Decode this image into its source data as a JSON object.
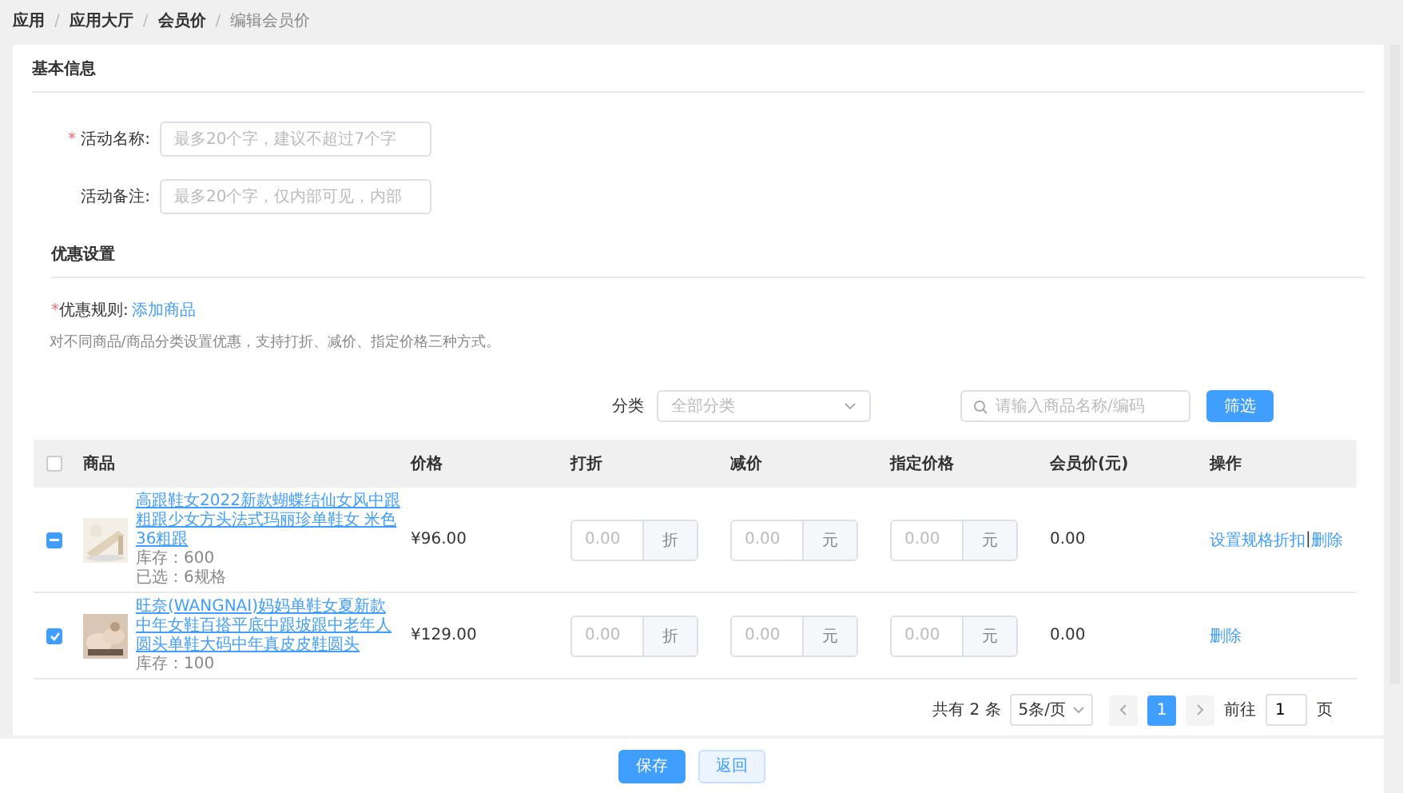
{
  "breadcrumb": [
    {
      "label": "应用",
      "current": false
    },
    {
      "label": "应用大厅",
      "current": false
    },
    {
      "label": "会员价",
      "current": false
    },
    {
      "label": "编辑会员价",
      "current": true
    }
  ],
  "breadcrumb_separator": "/",
  "basic_section": {
    "title": "基本信息"
  },
  "required_mark": "*",
  "fields": [
    {
      "label": "活动名称:",
      "required": true,
      "placeholder": "最多20个字，建议不超过7个字"
    },
    {
      "label": "活动备注:",
      "required": false,
      "placeholder": "最多20个字，仅内部可见，内部"
    }
  ],
  "discount_section": {
    "title": "优惠设置",
    "rule_label": "优惠规则:",
    "required": true,
    "add_link": "添加商品",
    "hint": "对不同商品/商品分类设置优惠，支持打折、减价、指定价格三种方式。"
  },
  "filter": {
    "category_label": "分类",
    "category_placeholder": "全部分类",
    "search_placeholder": "请输入商品名称/编码",
    "button": "筛选"
  },
  "table": {
    "header_checkbox": {
      "checked": false
    },
    "columns": [
      "商品",
      "价格",
      "打折",
      "减价",
      "指定价格",
      "会员价(元)",
      "操作"
    ],
    "rows": [
      {
        "checked": true,
        "indeterminate": true,
        "name": "高跟鞋女2022新款蝴蝶结仙女风中跟粗跟少女方头法式玛丽珍单鞋女 米色36粗跟",
        "stock": "库存：600",
        "selected_specs": "已选：6规格",
        "price": "¥96.00",
        "discount": {
          "placeholder": "0.00",
          "unit": "折"
        },
        "reduce": {
          "placeholder": "0.00",
          "unit": "元"
        },
        "fixed": {
          "placeholder": "0.00",
          "unit": "元"
        },
        "member_price": "0.00",
        "actions": [
          {
            "label": "设置规格折扣"
          },
          {
            "label": "删除"
          }
        ],
        "action_separator": "|"
      },
      {
        "checked": true,
        "indeterminate": false,
        "name": "旺奈(WANGNAI)妈妈单鞋女夏新款中年女鞋百搭平底中跟坡跟中老年人圆头单鞋大码中年真皮皮鞋圆头",
        "stock": "库存：100",
        "price": "¥129.00",
        "discount": {
          "placeholder": "0.00",
          "unit": "折"
        },
        "reduce": {
          "placeholder": "0.00",
          "unit": "元"
        },
        "fixed": {
          "placeholder": "0.00",
          "unit": "元"
        },
        "member_price": "0.00",
        "actions": [
          {
            "label": "删除"
          }
        ]
      }
    ]
  },
  "pagination": {
    "total": "共有 2 条",
    "page_size": "5条/页",
    "pages": [
      {
        "label": "1",
        "selected": true
      }
    ],
    "goto_label": "前往",
    "goto_value": "1",
    "page_unit": "页"
  },
  "footer": {
    "buttons": [
      {
        "label": "保存",
        "kind": "primary"
      },
      {
        "label": "返回",
        "kind": "secondary"
      }
    ]
  }
}
